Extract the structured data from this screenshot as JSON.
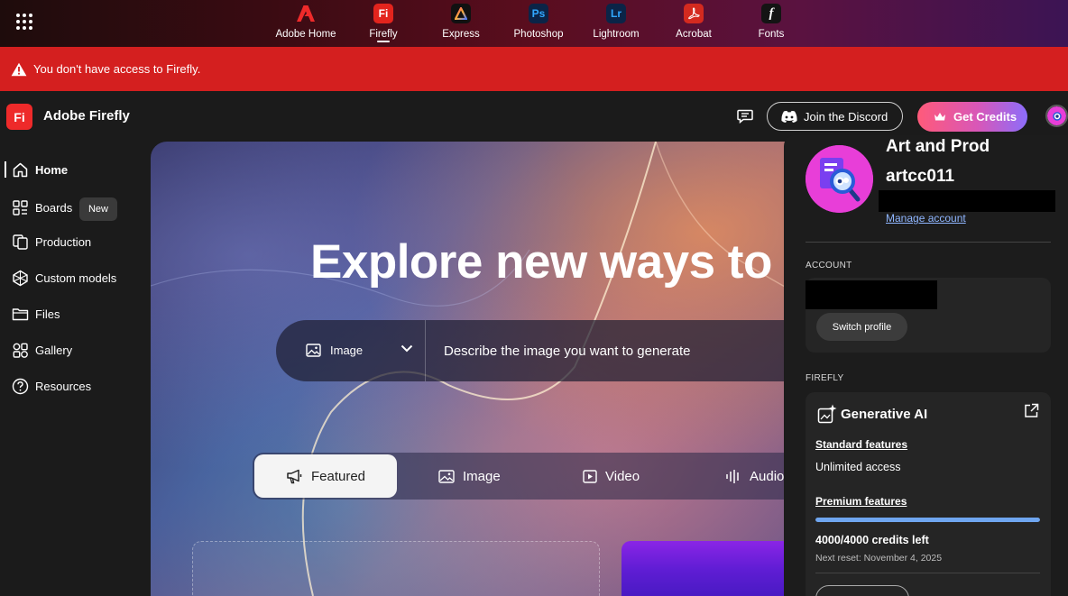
{
  "topbar": {
    "apps": [
      {
        "label": "Adobe Home",
        "icon": "adobe-logo-icon",
        "glyph": "A",
        "color": "#e3241d",
        "active": false
      },
      {
        "label": "Firefly",
        "icon": "firefly-app-icon",
        "glyph": "Fi",
        "color": "#e3241d",
        "active": true
      },
      {
        "label": "Express",
        "icon": "express-app-icon",
        "glyph": "A",
        "color": "#111111",
        "active": false
      },
      {
        "label": "Photoshop",
        "icon": "photoshop-app-icon",
        "glyph": "Ps",
        "color": "#0b2447",
        "active": false
      },
      {
        "label": "Lightroom",
        "icon": "lightroom-app-icon",
        "glyph": "Lr",
        "color": "#0b2447",
        "active": false
      },
      {
        "label": "Acrobat",
        "icon": "acrobat-app-icon",
        "glyph": "",
        "color": "#d42a1f",
        "active": false
      },
      {
        "label": "Fonts",
        "icon": "fonts-app-icon",
        "glyph": "f",
        "color": "#141414",
        "active": false
      }
    ]
  },
  "alert": {
    "text": "You don't have access to Firefly.",
    "color": "#d41f1f"
  },
  "header": {
    "logo": "Fi",
    "title": "Adobe Firefly",
    "discord_label": "Join the Discord",
    "credits_label": "Get Credits"
  },
  "sidebar": {
    "items": [
      {
        "label": "Home",
        "icon": "home-icon"
      },
      {
        "label": "Boards",
        "icon": "boards-icon"
      },
      {
        "label": "Production",
        "icon": "production-icon"
      },
      {
        "label": "Custom models",
        "icon": "custom-models-icon"
      },
      {
        "label": "Files",
        "icon": "folder-icon"
      },
      {
        "label": "Gallery",
        "icon": "gallery-icon"
      },
      {
        "label": "Resources",
        "icon": "help-icon"
      }
    ],
    "new_badge": "New"
  },
  "hero": {
    "headline": "Explore new ways to c",
    "type_select": "Image",
    "prompt_placeholder": "Describe the image you want to generate",
    "tabs": [
      {
        "label": "Featured",
        "icon": "megaphone-icon"
      },
      {
        "label": "Image",
        "icon": "image-icon"
      },
      {
        "label": "Video",
        "icon": "video-icon"
      },
      {
        "label": "Audio",
        "icon": "audio-icon"
      }
    ]
  },
  "account_panel": {
    "profile_name": "Art and Prod",
    "username": "artcc011",
    "manage_account": "Manage account",
    "account_label": "ACCOUNT",
    "switch_profile": "Switch profile",
    "firefly_label": "FIREFLY",
    "generative_ai_title": "Generative AI",
    "standard_features": "Standard features",
    "standard_value": "Unlimited access",
    "premium_features": "Premium features",
    "credits_left": "4000/4000 credits left",
    "credits_fraction": 1.0,
    "next_reset": "Next reset: November 4, 2025"
  },
  "colors": {
    "accent_blue": "#6fa6f0",
    "link_blue": "#8fb6ff",
    "alert_red": "#d41f1f"
  }
}
